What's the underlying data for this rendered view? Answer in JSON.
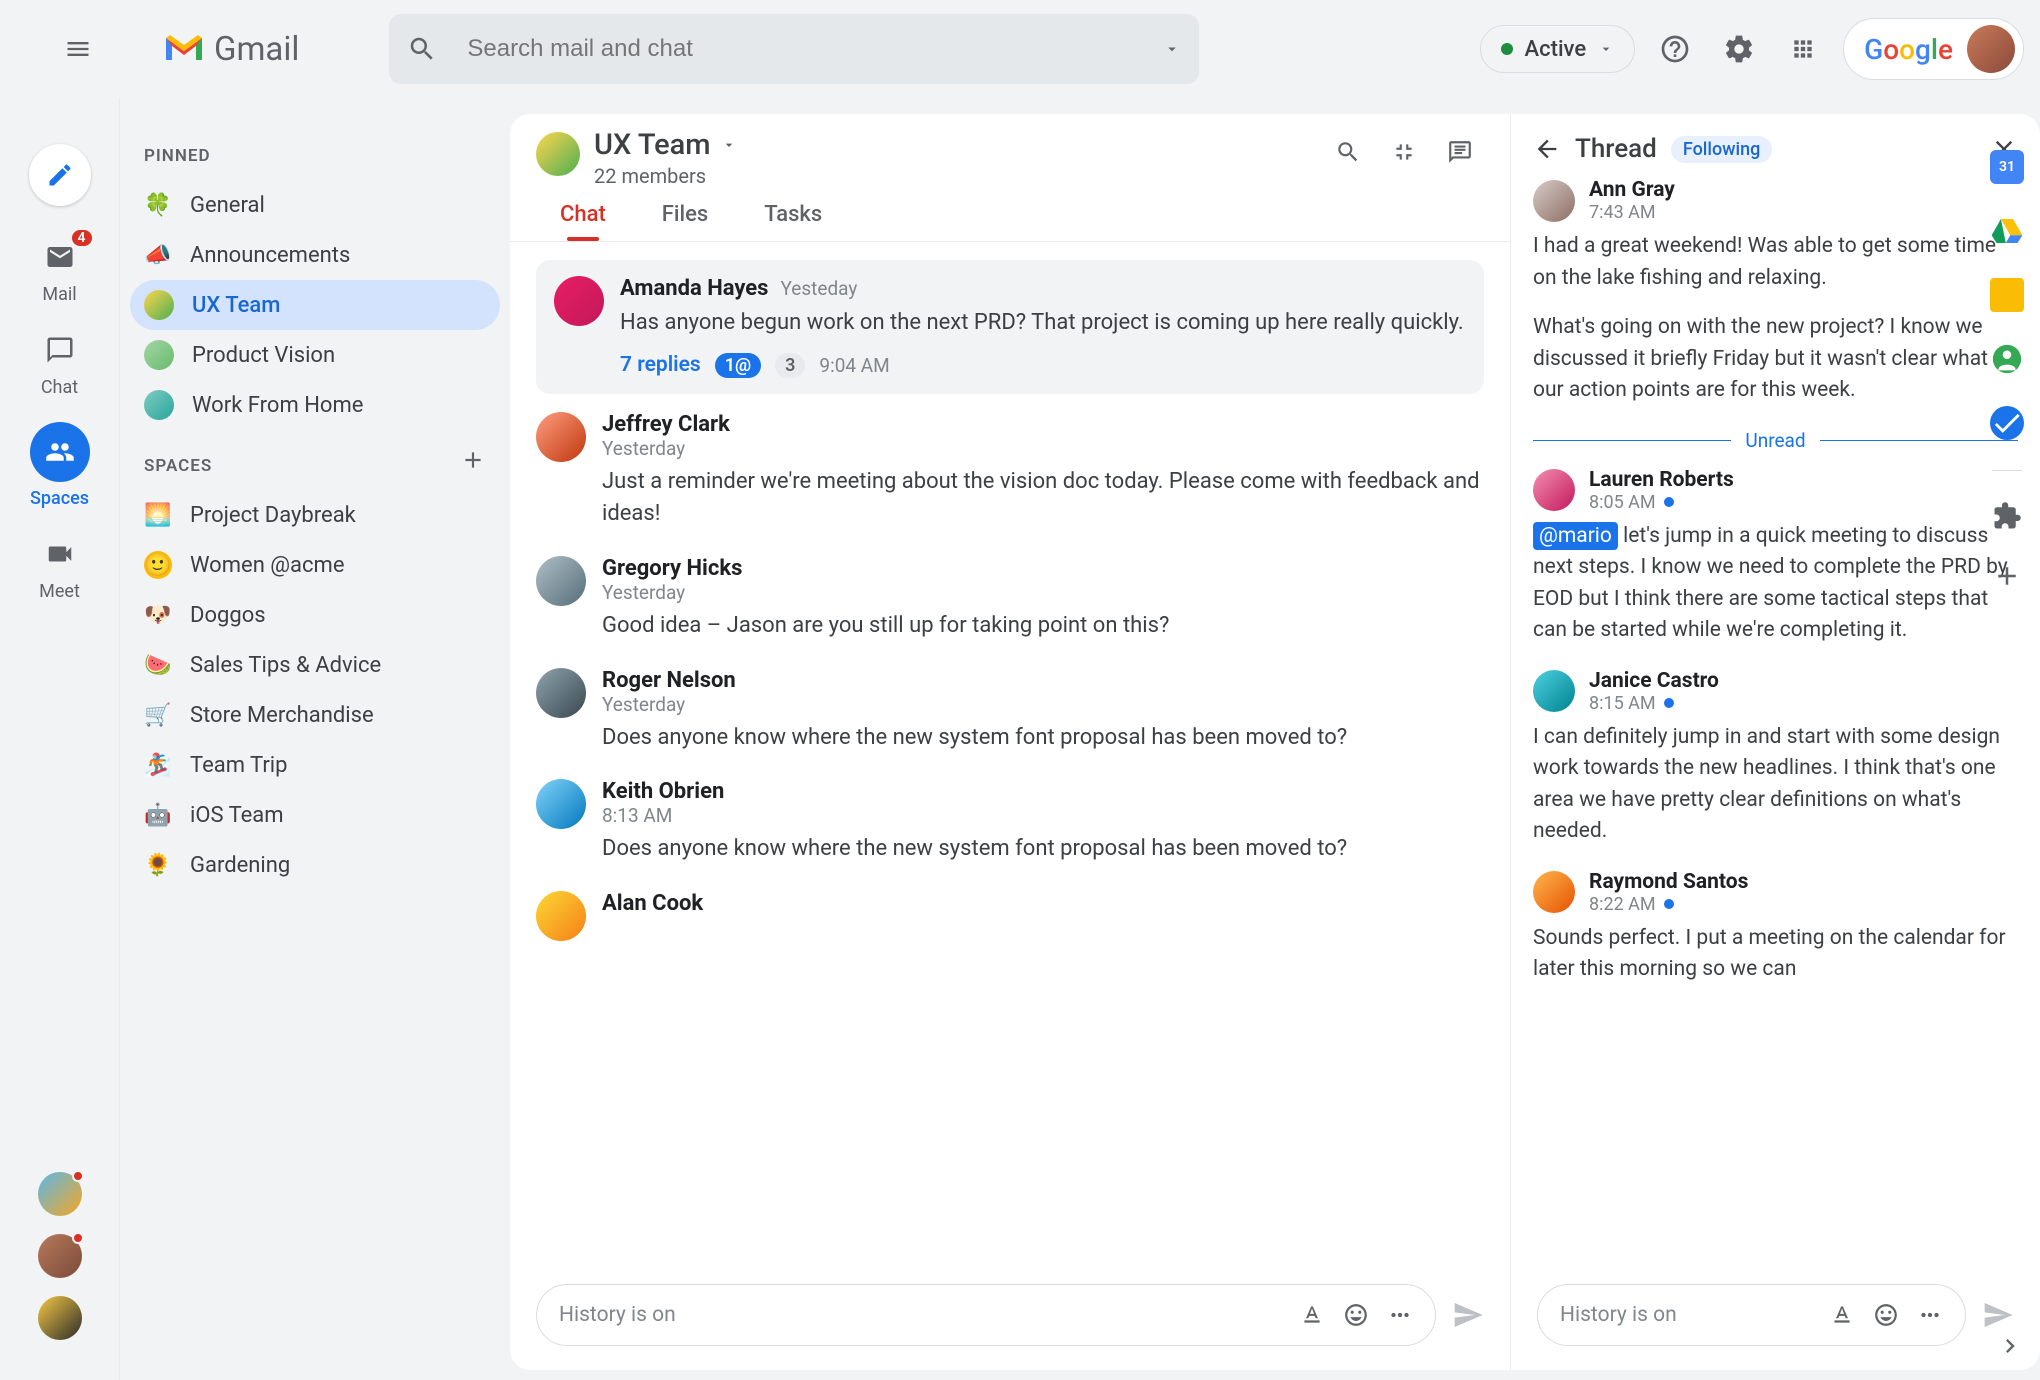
{
  "header": {
    "logo_text": "Gmail",
    "search_placeholder": "Search mail and chat",
    "status_label": "Active",
    "google_label": "Google"
  },
  "left_rail": {
    "mail": {
      "label": "Mail",
      "badge": "4"
    },
    "chat": {
      "label": "Chat"
    },
    "spaces": {
      "label": "Spaces"
    },
    "meet": {
      "label": "Meet"
    }
  },
  "sidebar": {
    "pinned_title": "PINNED",
    "pinned": [
      {
        "icon": "🍀",
        "label": "General"
      },
      {
        "icon": "📣",
        "label": "Announcements"
      },
      {
        "icon": "avatar",
        "label": "UX Team",
        "selected": true
      },
      {
        "icon": "avatar2",
        "label": "Product Vision"
      },
      {
        "icon": "avatar3",
        "label": "Work From Home"
      }
    ],
    "spaces_title": "SPACES",
    "spaces": [
      {
        "icon": "🌅",
        "label": "Project Daybreak"
      },
      {
        "icon": "🙂",
        "label": "Women @acme"
      },
      {
        "icon": "🐶",
        "label": "Doggos"
      },
      {
        "icon": "🍉",
        "label": "Sales Tips & Advice"
      },
      {
        "icon": "🛒",
        "label": "Store Merchandise"
      },
      {
        "icon": "🏂",
        "label": "Team Trip"
      },
      {
        "icon": "🤖",
        "label": "iOS Team"
      },
      {
        "icon": "🌻",
        "label": "Gardening"
      }
    ]
  },
  "chat": {
    "title": "UX Team",
    "subtitle": "22 members",
    "tabs": [
      "Chat",
      "Files",
      "Tasks"
    ],
    "messages": [
      {
        "name": "Amanda Hayes",
        "time": "Yesteday",
        "text": "Has anyone begun work on the next PRD? That project is coming up here really quickly.",
        "highlighted": true,
        "replies": {
          "count_label": "7 replies",
          "mention": "1@",
          "num": "3",
          "time": "9:04 AM"
        }
      },
      {
        "name": "Jeffrey Clark",
        "time": "Yesterday",
        "text": "Just a reminder we're meeting about the vision doc today. Please come with feedback and ideas!"
      },
      {
        "name": "Gregory Hicks",
        "time": "Yesterday",
        "text": "Good idea – Jason are you still up for taking point on this?"
      },
      {
        "name": "Roger Nelson",
        "time": "Yesterday",
        "text": "Does anyone know where the new system font proposal has been moved to?"
      },
      {
        "name": "Keith Obrien",
        "time": "8:13 AM",
        "text": "Does anyone know where the new system font proposal has been moved to?"
      },
      {
        "name": "Alan Cook",
        "time": "",
        "text": ""
      }
    ],
    "compose_hint": "History is on"
  },
  "thread": {
    "title": "Thread",
    "following": "Following",
    "unread_label": "Unread",
    "messages": [
      {
        "name": "Ann Gray",
        "time": "7:43 AM",
        "text": "I had a great weekend! Was able to get some time on the lake fishing and relaxing.",
        "text2": "What's going on with the new project? I know we discussed it briefly Friday but it wasn't clear what our action points are for this week."
      },
      {
        "name": "Lauren Roberts",
        "time": "8:05 AM",
        "unread": true,
        "mention": "@mario",
        "text": "let's jump in a quick meeting to discuss next steps. I know we need to complete the PRD by EOD but I think there are some tactical steps that can be started while we're completing it."
      },
      {
        "name": "Janice Castro",
        "time": "8:15 AM",
        "unread": true,
        "text": "I can definitely jump in and start with some design work towards the new headlines. I think that's one area we have pretty clear definitions on what's needed."
      },
      {
        "name": "Raymond Santos",
        "time": "8:22 AM",
        "unread": true,
        "text": "Sounds perfect. I put a meeting on the calendar for later this morning so we can"
      }
    ],
    "compose_hint": "History is on"
  }
}
